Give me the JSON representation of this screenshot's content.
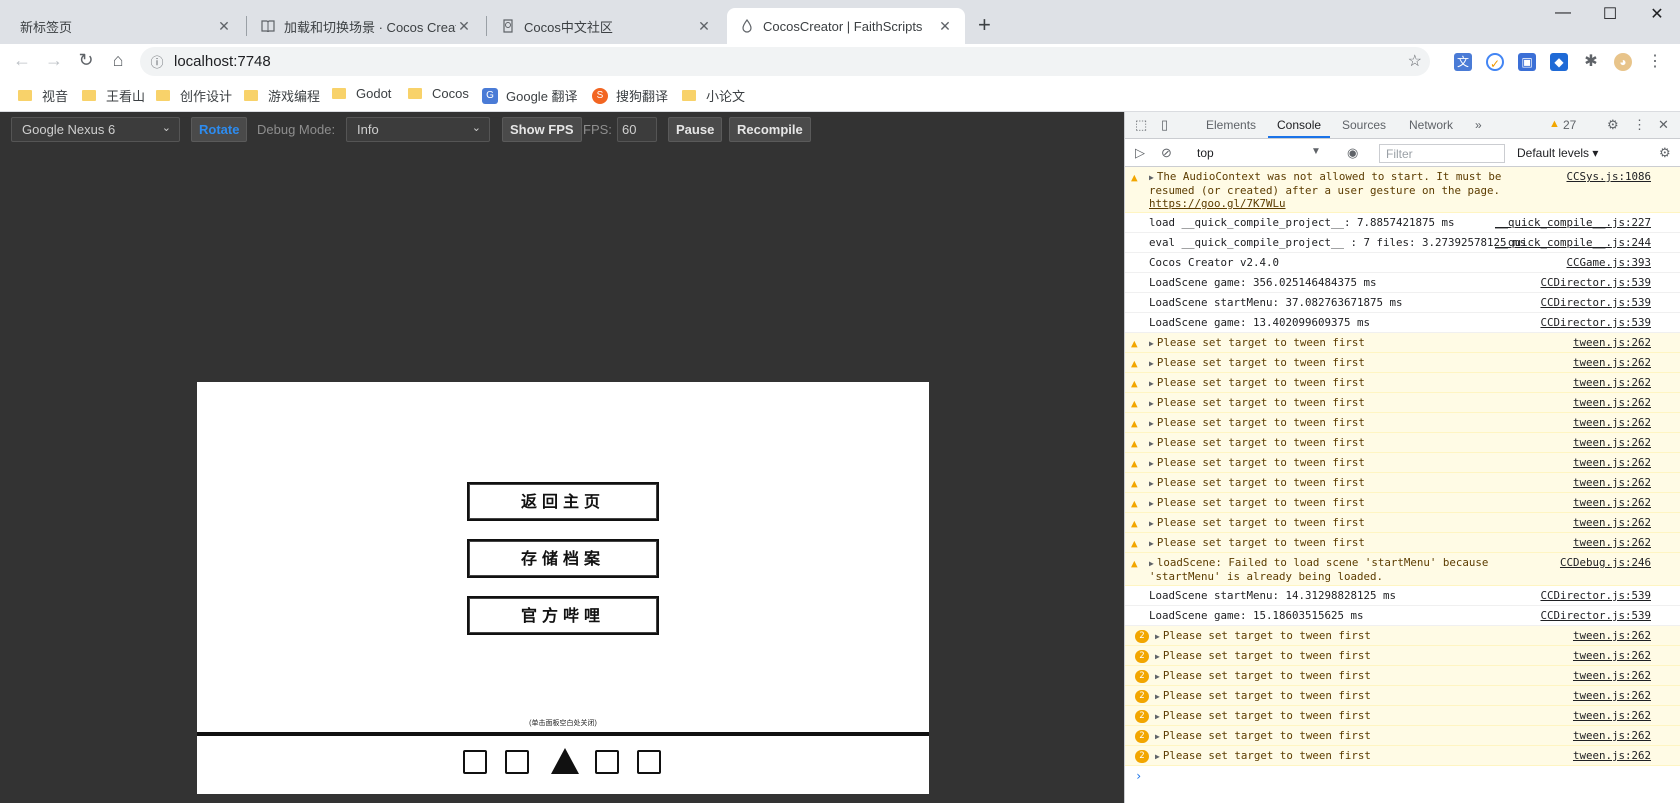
{
  "browser": {
    "tabs": [
      {
        "title": "新标签页",
        "icon": ""
      },
      {
        "title": "加载和切换场景 · Cocos Creator",
        "icon": "book-icon"
      },
      {
        "title": "Cocos中文社区",
        "icon": "cocos-community-icon"
      },
      {
        "title": "CocosCreator | FaithScripts",
        "icon": "cocos-creator-icon"
      }
    ],
    "new_tab": "+",
    "window_controls": {
      "minimize": "—",
      "maximize": "☐",
      "close": "✕"
    },
    "address": "localhost:7748",
    "bookmarks": [
      {
        "label": "视音",
        "icon": "folder-icon"
      },
      {
        "label": "王看山",
        "icon": "folder-icon"
      },
      {
        "label": "创作设计",
        "icon": "folder-icon"
      },
      {
        "label": "游戏编程",
        "icon": "folder-icon"
      },
      {
        "label": "Godot",
        "icon": "folder-icon"
      },
      {
        "label": "Cocos",
        "icon": "folder-icon"
      },
      {
        "label": "Google 翻译",
        "icon": "google-translate-icon"
      },
      {
        "label": "搜狗翻译",
        "icon": "sogou-icon"
      },
      {
        "label": "小论文",
        "icon": "folder-icon"
      }
    ]
  },
  "preview_toolbar": {
    "device": "Google Nexus 6",
    "rotate": "Rotate",
    "debug_mode_label": "Debug Mode:",
    "debug_mode_value": "Info",
    "show_fps": "Show FPS",
    "fps_label": "FPS:",
    "fps_value": "60",
    "pause": "Pause",
    "recompile": "Recompile"
  },
  "game": {
    "buttons": [
      "返回主页",
      "存储档案",
      "官方哔哩"
    ],
    "hint": "(单击面板空白处关闭)"
  },
  "devtools": {
    "tabs": [
      "Elements",
      "Console",
      "Sources",
      "Network"
    ],
    "more": "»",
    "warning_count": "27",
    "context": "top",
    "filter_placeholder": "Filter",
    "levels": "Default levels ▾",
    "messages": [
      {
        "type": "warn",
        "expand": true,
        "text": "The AudioContext was not allowed to start. It must be resumed (or created) after a user gesture on the page. ",
        "link": "https://goo.gl/7K7WLu",
        "source": "CCSys.js:1086"
      },
      {
        "type": "log",
        "text": "load __quick_compile_project__: 7.8857421875 ms",
        "source": "__quick_compile__.js:227"
      },
      {
        "type": "log",
        "text": "eval __quick_compile_project__ : 7 files: 3.27392578125 ms",
        "source": "__quick_compile__.js:244"
      },
      {
        "type": "log",
        "text": "Cocos Creator v2.4.0",
        "source": "CCGame.js:393"
      },
      {
        "type": "log",
        "text": "LoadScene game: 356.025146484375 ms",
        "source": "CCDirector.js:539"
      },
      {
        "type": "log",
        "text": "LoadScene startMenu: 37.082763671875 ms",
        "source": "CCDirector.js:539"
      },
      {
        "type": "log",
        "text": "LoadScene game: 13.402099609375 ms",
        "source": "CCDirector.js:539"
      },
      {
        "type": "warn",
        "expand": true,
        "text": "Please set target to tween first",
        "source": "tween.js:262"
      },
      {
        "type": "warn",
        "expand": true,
        "text": "Please set target to tween first",
        "source": "tween.js:262"
      },
      {
        "type": "warn",
        "expand": true,
        "text": "Please set target to tween first",
        "source": "tween.js:262"
      },
      {
        "type": "warn",
        "expand": true,
        "text": "Please set target to tween first",
        "source": "tween.js:262"
      },
      {
        "type": "warn",
        "expand": true,
        "text": "Please set target to tween first",
        "source": "tween.js:262"
      },
      {
        "type": "warn",
        "expand": true,
        "text": "Please set target to tween first",
        "source": "tween.js:262"
      },
      {
        "type": "warn",
        "expand": true,
        "text": "Please set target to tween first",
        "source": "tween.js:262"
      },
      {
        "type": "warn",
        "expand": true,
        "text": "Please set target to tween first",
        "source": "tween.js:262"
      },
      {
        "type": "warn",
        "expand": true,
        "text": "Please set target to tween first",
        "source": "tween.js:262"
      },
      {
        "type": "warn",
        "expand": true,
        "text": "Please set target to tween first",
        "source": "tween.js:262"
      },
      {
        "type": "warn",
        "expand": true,
        "text": "Please set target to tween first",
        "source": "tween.js:262"
      },
      {
        "type": "warn",
        "expand": true,
        "text": "loadScene: Failed to load scene 'startMenu' because 'startMenu' is already being loaded.",
        "source": "CCDebug.js:246"
      },
      {
        "type": "log",
        "text": "LoadScene startMenu: 14.31298828125 ms",
        "source": "CCDirector.js:539"
      },
      {
        "type": "log",
        "text": "LoadScene game: 15.18603515625 ms",
        "source": "CCDirector.js:539"
      },
      {
        "type": "group",
        "count": "2",
        "text": "Please set target to tween first",
        "source": "tween.js:262"
      },
      {
        "type": "group",
        "count": "2",
        "text": "Please set target to tween first",
        "source": "tween.js:262"
      },
      {
        "type": "group",
        "count": "2",
        "text": "Please set target to tween first",
        "source": "tween.js:262"
      },
      {
        "type": "group",
        "count": "2",
        "text": "Please set target to tween first",
        "source": "tween.js:262"
      },
      {
        "type": "group",
        "count": "2",
        "text": "Please set target to tween first",
        "source": "tween.js:262"
      },
      {
        "type": "group",
        "count": "2",
        "text": "Please set target to tween first",
        "source": "tween.js:262"
      },
      {
        "type": "group",
        "count": "2",
        "text": "Please set target to tween first",
        "source": "tween.js:262"
      }
    ],
    "prompt": "›"
  }
}
